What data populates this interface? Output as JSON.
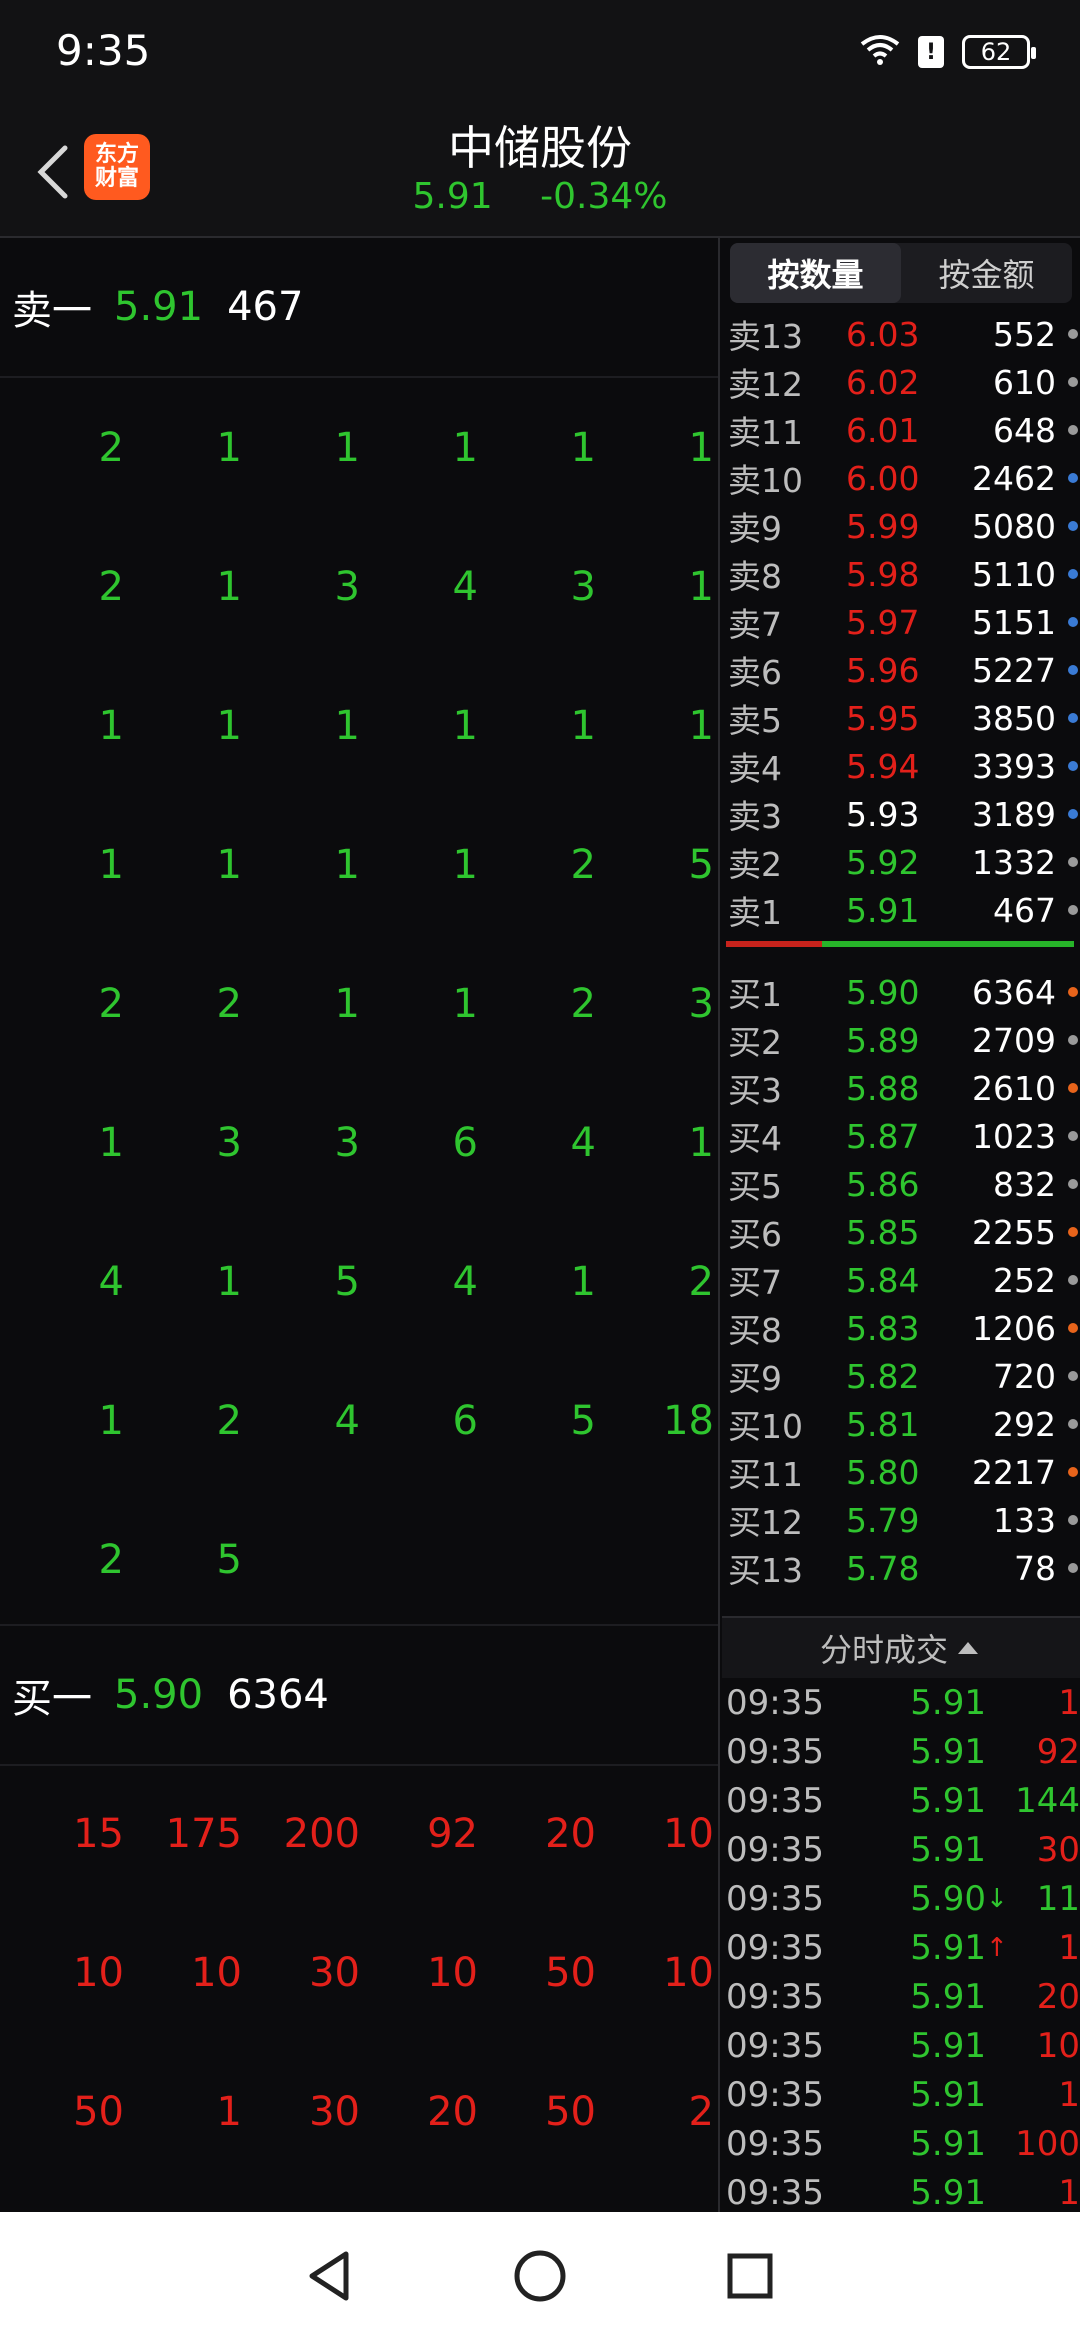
{
  "status": {
    "time": "9:35",
    "battery": "62"
  },
  "header": {
    "app_logo_line1": "东方",
    "app_logo_line2": "财富",
    "stock_name": "中储股份",
    "price": "5.91",
    "change": "-0.34%"
  },
  "level1": {
    "ask_label": "卖一",
    "ask_price": "5.91",
    "ask_volume": "467",
    "bid_label": "买一",
    "bid_price": "5.90",
    "bid_volume": "6364"
  },
  "ask_queue": [
    [
      "2",
      "1",
      "1",
      "1",
      "1",
      "1"
    ],
    [
      "2",
      "1",
      "3",
      "4",
      "3",
      "1"
    ],
    [
      "1",
      "1",
      "1",
      "1",
      "1",
      "1"
    ],
    [
      "1",
      "1",
      "1",
      "1",
      "2",
      "5"
    ],
    [
      "2",
      "2",
      "1",
      "1",
      "2",
      "3"
    ],
    [
      "1",
      "3",
      "3",
      "6",
      "4",
      "1"
    ],
    [
      "4",
      "1",
      "5",
      "4",
      "1",
      "2"
    ],
    [
      "1",
      "2",
      "4",
      "6",
      "5",
      "18"
    ],
    [
      "2",
      "5",
      "",
      "",
      "",
      ""
    ]
  ],
  "bid_queue": [
    [
      "15",
      "175",
      "200",
      "92",
      "20",
      "10"
    ],
    [
      "10",
      "10",
      "30",
      "10",
      "50",
      "10"
    ],
    [
      "50",
      "1",
      "30",
      "20",
      "50",
      "2"
    ]
  ],
  "toggle": {
    "by_volume": "按数量",
    "by_amount": "按金额"
  },
  "order_book": {
    "asks": [
      {
        "label": "卖13",
        "price": "6.03",
        "volume": "552",
        "pc": "red",
        "dot": "#9a9a9a"
      },
      {
        "label": "卖12",
        "price": "6.02",
        "volume": "610",
        "pc": "red",
        "dot": "#9a9a9a"
      },
      {
        "label": "卖11",
        "price": "6.01",
        "volume": "648",
        "pc": "red",
        "dot": "#9a9a9a"
      },
      {
        "label": "卖10",
        "price": "6.00",
        "volume": "2462",
        "pc": "red",
        "dot": "#3a7bd5"
      },
      {
        "label": "卖9",
        "price": "5.99",
        "volume": "5080",
        "pc": "red",
        "dot": "#3a7bd5"
      },
      {
        "label": "卖8",
        "price": "5.98",
        "volume": "5110",
        "pc": "red",
        "dot": "#3a7bd5"
      },
      {
        "label": "卖7",
        "price": "5.97",
        "volume": "5151",
        "pc": "red",
        "dot": "#3a7bd5"
      },
      {
        "label": "卖6",
        "price": "5.96",
        "volume": "5227",
        "pc": "red",
        "dot": "#3a7bd5"
      },
      {
        "label": "卖5",
        "price": "5.95",
        "volume": "3850",
        "pc": "red",
        "dot": "#3a7bd5"
      },
      {
        "label": "卖4",
        "price": "5.94",
        "volume": "3393",
        "pc": "red",
        "dot": "#3a7bd5"
      },
      {
        "label": "卖3",
        "price": "5.93",
        "volume": "3189",
        "pc": "white",
        "dot": "#3a7bd5"
      },
      {
        "label": "卖2",
        "price": "5.92",
        "volume": "1332",
        "pc": "green",
        "dot": "#9a9a9a"
      },
      {
        "label": "卖1",
        "price": "5.91",
        "volume": "467",
        "pc": "green",
        "dot": "#9a9a9a"
      }
    ],
    "bids": [
      {
        "label": "买1",
        "price": "5.90",
        "volume": "6364",
        "pc": "green",
        "dot": "#e8641b"
      },
      {
        "label": "买2",
        "price": "5.89",
        "volume": "2709",
        "pc": "green",
        "dot": "#9a9a9a"
      },
      {
        "label": "买3",
        "price": "5.88",
        "volume": "2610",
        "pc": "green",
        "dot": "#e8641b"
      },
      {
        "label": "买4",
        "price": "5.87",
        "volume": "1023",
        "pc": "green",
        "dot": "#9a9a9a"
      },
      {
        "label": "买5",
        "price": "5.86",
        "volume": "832",
        "pc": "green",
        "dot": "#9a9a9a"
      },
      {
        "label": "买6",
        "price": "5.85",
        "volume": "2255",
        "pc": "green",
        "dot": "#e8641b"
      },
      {
        "label": "买7",
        "price": "5.84",
        "volume": "252",
        "pc": "green",
        "dot": "#9a9a9a"
      },
      {
        "label": "买8",
        "price": "5.83",
        "volume": "1206",
        "pc": "green",
        "dot": "#e8641b"
      },
      {
        "label": "买9",
        "price": "5.82",
        "volume": "720",
        "pc": "green",
        "dot": "#9a9a9a"
      },
      {
        "label": "买10",
        "price": "5.81",
        "volume": "292",
        "pc": "green",
        "dot": "#9a9a9a"
      },
      {
        "label": "买11",
        "price": "5.80",
        "volume": "2217",
        "pc": "green",
        "dot": "#e8641b"
      },
      {
        "label": "买12",
        "price": "5.79",
        "volume": "133",
        "pc": "green",
        "dot": "#9a9a9a"
      },
      {
        "label": "买13",
        "price": "5.78",
        "volume": "78",
        "pc": "green",
        "dot": "#9a9a9a"
      }
    ]
  },
  "trades": {
    "title": "分时成交",
    "rows": [
      {
        "time": "09:35",
        "price": "5.91",
        "arrow": "",
        "volume": "1",
        "vc": "red"
      },
      {
        "time": "09:35",
        "price": "5.91",
        "arrow": "",
        "volume": "92",
        "vc": "red"
      },
      {
        "time": "09:35",
        "price": "5.91",
        "arrow": "",
        "volume": "144",
        "vc": "green"
      },
      {
        "time": "09:35",
        "price": "5.91",
        "arrow": "",
        "volume": "30",
        "vc": "red"
      },
      {
        "time": "09:35",
        "price": "5.90",
        "arrow": "↓",
        "volume": "11",
        "vc": "green"
      },
      {
        "time": "09:35",
        "price": "5.91",
        "arrow": "↑",
        "volume": "1",
        "vc": "red"
      },
      {
        "time": "09:35",
        "price": "5.91",
        "arrow": "",
        "volume": "20",
        "vc": "red"
      },
      {
        "time": "09:35",
        "price": "5.91",
        "arrow": "",
        "volume": "10",
        "vc": "red"
      },
      {
        "time": "09:35",
        "price": "5.91",
        "arrow": "",
        "volume": "1",
        "vc": "red"
      },
      {
        "time": "09:35",
        "price": "5.91",
        "arrow": "",
        "volume": "100",
        "vc": "red"
      },
      {
        "time": "09:35",
        "price": "5.91",
        "arrow": "",
        "volume": "1",
        "vc": "red"
      }
    ]
  },
  "colors": {
    "up": "#e3201a",
    "down": "#2fc52f",
    "bg": "#0b0b0d"
  }
}
